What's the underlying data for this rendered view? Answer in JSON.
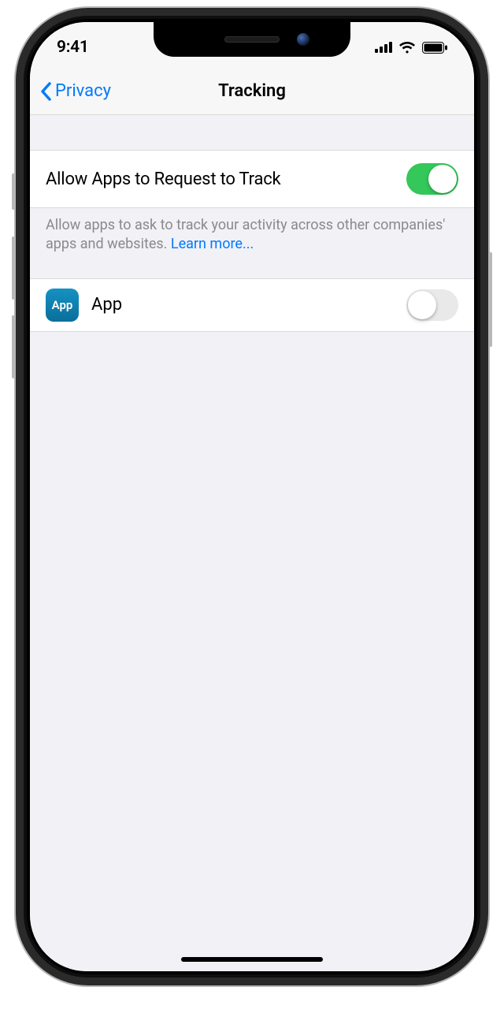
{
  "status": {
    "time": "9:41"
  },
  "nav": {
    "back_label": "Privacy",
    "title": "Tracking"
  },
  "settings": {
    "allow_track_label": "Allow Apps to Request to Track",
    "allow_track_on": true,
    "footer_text": "Allow apps to ask to track your activity across other companies' apps and websites. ",
    "learn_more": "Learn more..."
  },
  "apps": [
    {
      "icon_text": "App",
      "name": "App",
      "toggle_on": false
    }
  ]
}
